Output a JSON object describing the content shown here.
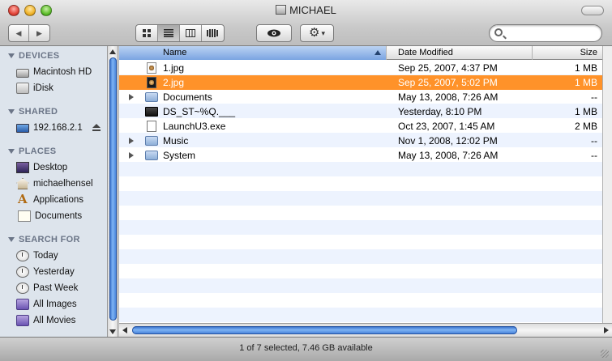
{
  "window": {
    "title": "MICHAEL"
  },
  "toolbar": {
    "back_glyph": "◀",
    "forward_glyph": "▶",
    "view_icons": [
      "icon-view-icon",
      "list-view-icon",
      "column-view-icon",
      "coverflow-view-icon"
    ],
    "active_view": "list-view-icon",
    "quicklook_icon": "eye-icon",
    "action_icon": "gear-icon",
    "gear_glyph": "⚙",
    "caret_glyph": "▾",
    "eye_glyph": "◉",
    "search": {
      "value": "",
      "placeholder": ""
    }
  },
  "sidebar": {
    "devices": {
      "header": "DEVICES",
      "items": [
        {
          "label": "Macintosh HD",
          "icon": "hard-drive-icon"
        },
        {
          "label": "iDisk",
          "icon": "idisk-icon"
        }
      ]
    },
    "shared": {
      "header": "SHARED",
      "items": [
        {
          "label": "192.168.2.1",
          "icon": "monitor-icon",
          "eject": true
        }
      ]
    },
    "places": {
      "header": "PLACES",
      "items": [
        {
          "label": "Desktop",
          "icon": "desktop-icon"
        },
        {
          "label": "michaelhensel",
          "icon": "home-icon"
        },
        {
          "label": "Applications",
          "icon": "applications-icon"
        },
        {
          "label": "Documents",
          "icon": "documents-icon"
        }
      ]
    },
    "search_for": {
      "header": "SEARCH FOR",
      "items": [
        {
          "label": "Today",
          "icon": "clock-icon"
        },
        {
          "label": "Yesterday",
          "icon": "clock-icon"
        },
        {
          "label": "Past Week",
          "icon": "clock-icon"
        },
        {
          "label": "All Images",
          "icon": "smart-folder-icon"
        },
        {
          "label": "All Movies",
          "icon": "smart-folder-icon"
        }
      ]
    }
  },
  "file_list": {
    "columns": {
      "name": "Name",
      "date": "Date Modified",
      "size": "Size"
    },
    "rows": [
      {
        "name": "1.jpg",
        "date": "Sep 25, 2007, 4:37 PM",
        "size": "1 MB",
        "icon": "jpg-file-icon",
        "folder": false,
        "selected": false
      },
      {
        "name": "2.jpg",
        "date": "Sep 25, 2007, 5:02 PM",
        "size": "1 MB",
        "icon": "jpg-file-icon",
        "folder": false,
        "selected": true
      },
      {
        "name": "Documents",
        "date": "May 13, 2008, 7:26 AM",
        "size": "--",
        "icon": "folder-icon",
        "folder": true,
        "selected": false
      },
      {
        "name": "DS_ST~%Q.___",
        "date": "Yesterday, 8:10 PM",
        "size": "1 MB",
        "icon": "black-file-icon",
        "folder": false,
        "selected": false
      },
      {
        "name": "LaunchU3.exe",
        "date": "Oct 23, 2007, 1:45 AM",
        "size": "2 MB",
        "icon": "exe-file-icon",
        "folder": false,
        "selected": false
      },
      {
        "name": "Music",
        "date": "Nov 1, 2008, 12:02 PM",
        "size": "--",
        "icon": "folder-icon",
        "folder": true,
        "selected": false
      },
      {
        "name": "System",
        "date": "May 13, 2008, 7:26 AM",
        "size": "--",
        "icon": "folder-icon",
        "folder": true,
        "selected": false
      }
    ]
  },
  "status_bar": {
    "text": "1 of 7 selected, 7.46 GB available"
  },
  "colors": {
    "selection": "#ff9229",
    "sidebar_bg": "#dde4ec",
    "scroll_thumb": "#3d7ad6"
  }
}
